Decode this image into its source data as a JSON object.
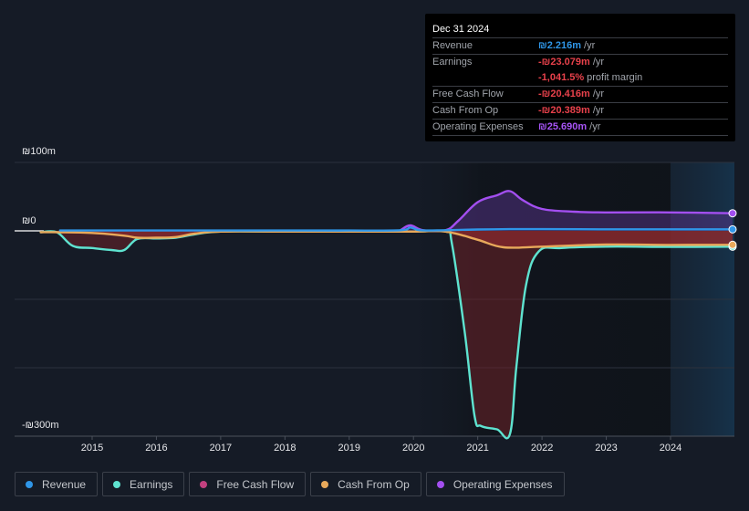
{
  "tooltip": {
    "date": "Dec 31 2024",
    "rows": [
      {
        "label": "Revenue",
        "value": "₪2.216m",
        "unit": "/yr",
        "color": "#2f96e8"
      },
      {
        "label": "Earnings",
        "value": "-₪23.079m",
        "unit": "/yr",
        "color": "#e8414b"
      },
      {
        "label": "",
        "value": "-1,041.5%",
        "unit": "profit margin",
        "color": "#e8414b"
      },
      {
        "label": "Free Cash Flow",
        "value": "-₪20.416m",
        "unit": "/yr",
        "color": "#e8414b"
      },
      {
        "label": "Cash From Op",
        "value": "-₪20.389m",
        "unit": "/yr",
        "color": "#e8414b"
      },
      {
        "label": "Operating Expenses",
        "value": "₪25.690m",
        "unit": "/yr",
        "color": "#a855f7"
      }
    ]
  },
  "legend": [
    {
      "label": "Revenue",
      "color": "#2f96e8"
    },
    {
      "label": "Earnings",
      "color": "#5ee3d0"
    },
    {
      "label": "Free Cash Flow",
      "color": "#c2407f"
    },
    {
      "label": "Cash From Op",
      "color": "#e8a95b"
    },
    {
      "label": "Operating Expenses",
      "color": "#a34ff0"
    }
  ],
  "chart_data": {
    "type": "area",
    "title": "",
    "xlabel": "",
    "ylabel": "",
    "currency": "₪",
    "y_tick_labels": [
      "₪100m",
      "₪0",
      "-₪300m"
    ],
    "ylim": [
      -300,
      100
    ],
    "y_gridlines": [
      100,
      0,
      -100,
      -200,
      -300
    ],
    "x_tick_labels": [
      "2015",
      "2016",
      "2017",
      "2018",
      "2019",
      "2020",
      "2021",
      "2022",
      "2023",
      "2024"
    ],
    "xlim": [
      2014.2,
      2025.0
    ],
    "forecast_shade_start": 2024.0,
    "grid": true,
    "legend_position": "bottom",
    "series": [
      {
        "name": "Revenue",
        "color": "#2f96e8",
        "x": [
          2014.5,
          2015.0,
          2016.0,
          2017.0,
          2018.0,
          2019.0,
          2019.8,
          2019.95,
          2020.1,
          2020.5,
          2021.0,
          2021.5,
          2022.0,
          2023.0,
          2024.0,
          2025.0
        ],
        "values": [
          0.5,
          0.5,
          0.5,
          0.5,
          0.5,
          0.5,
          1,
          5,
          1,
          1,
          2,
          2.5,
          2.5,
          2.2,
          2.2,
          2.2
        ]
      },
      {
        "name": "Earnings",
        "color": "#5ee3d0",
        "x": [
          2014.2,
          2014.45,
          2014.7,
          2015.0,
          2015.3,
          2015.5,
          2015.7,
          2016.0,
          2016.3,
          2016.6,
          2017.0,
          2018.0,
          2019.0,
          2020.0,
          2020.5,
          2020.6,
          2020.8,
          2020.95,
          2021.05,
          2021.3,
          2021.5,
          2021.6,
          2021.75,
          2021.95,
          2022.3,
          2023.0,
          2024.0,
          2025.0
        ],
        "values": [
          -2,
          -2,
          -22,
          -25,
          -28,
          -28,
          -12,
          -11,
          -10,
          -5,
          -1,
          -1,
          -1,
          -1,
          -1,
          -20,
          -150,
          -270,
          -285,
          -290,
          -297,
          -200,
          -80,
          -30,
          -25,
          -23,
          -23.5,
          -23.1
        ]
      },
      {
        "name": "Free Cash Flow",
        "color": "#c2407f",
        "x": [
          2014.2,
          2014.5,
          2015.0,
          2015.5,
          2015.7,
          2016.0,
          2016.3,
          2016.6,
          2017.0,
          2018.0,
          2019.0,
          2020.0,
          2020.5,
          2021.0,
          2021.4,
          2022.0,
          2023.0,
          2024.0,
          2025.0
        ],
        "values": [
          -2,
          -2,
          -3,
          -7,
          -10,
          -10,
          -9,
          -4,
          -1,
          -1,
          -1,
          -1,
          -1,
          -13,
          -24,
          -23,
          -20,
          -20.5,
          -20.4
        ]
      },
      {
        "name": "Cash From Op",
        "color": "#e8a95b",
        "x": [
          2014.2,
          2014.5,
          2015.0,
          2015.5,
          2015.7,
          2016.0,
          2016.3,
          2016.6,
          2017.0,
          2018.0,
          2019.0,
          2020.0,
          2020.5,
          2021.0,
          2021.4,
          2022.0,
          2023.0,
          2024.0,
          2025.0
        ],
        "values": [
          -2,
          -2,
          -3,
          -7,
          -10,
          -10,
          -9,
          -4,
          -1,
          -1,
          -1,
          -1,
          -1,
          -13,
          -24,
          -23,
          -20,
          -20.5,
          -20.4
        ]
      },
      {
        "name": "Operating Expenses",
        "color": "#a34ff0",
        "x": [
          2019.8,
          2019.95,
          2020.15,
          2020.5,
          2020.7,
          2021.0,
          2021.3,
          2021.5,
          2021.7,
          2022.0,
          2022.5,
          2023.0,
          2024.0,
          2025.0
        ],
        "values": [
          1,
          8,
          1,
          1,
          15,
          42,
          52,
          58,
          45,
          32,
          28,
          27,
          27,
          25.7
        ]
      }
    ]
  }
}
